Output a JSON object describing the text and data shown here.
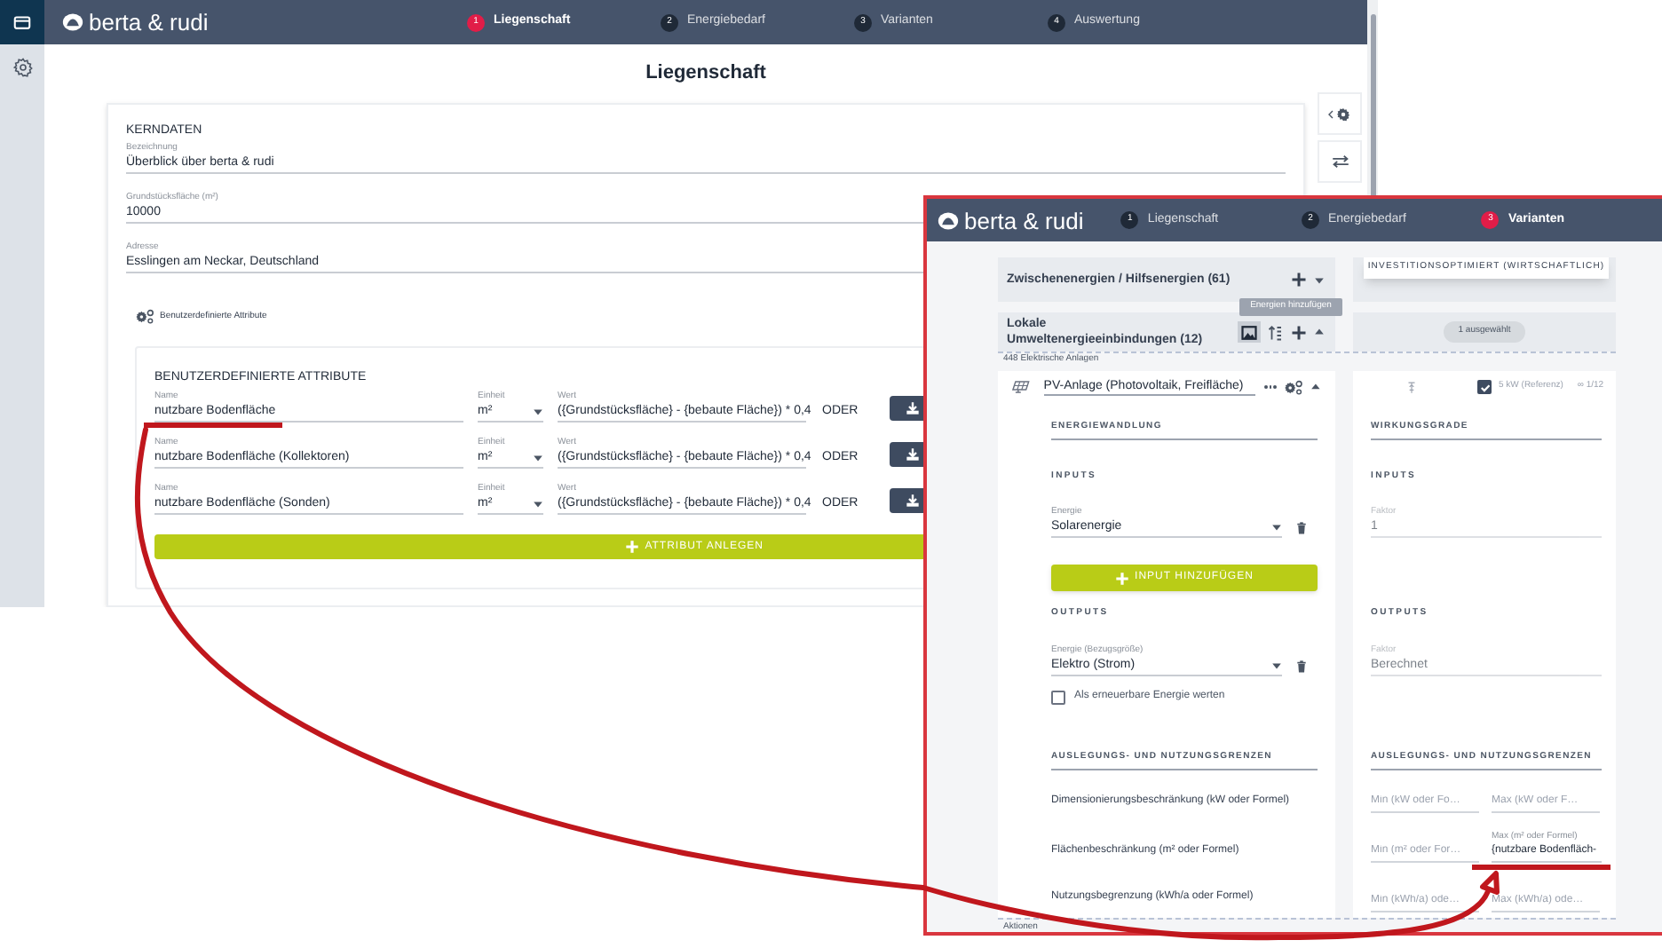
{
  "back_window": {
    "logo": "berta & rudi",
    "steps": [
      {
        "number": "1",
        "label": "Liegenschaft",
        "selected": true
      },
      {
        "number": "2",
        "label": "Energiebedarf",
        "selected": false
      },
      {
        "number": "3",
        "label": "Varianten",
        "selected": false
      },
      {
        "number": "4",
        "label": "Auswertung",
        "selected": false
      }
    ],
    "page_title": "Liegenschaft",
    "core_data": {
      "heading": "KERNDATEN",
      "fields": [
        {
          "label": "Bezeichnung",
          "value": "Überblick über berta & rudi"
        },
        {
          "label": "Grundstücksfläche (m²)",
          "value": "10000"
        },
        {
          "label": "Adresse",
          "value": "Esslingen am Neckar, Deutschland"
        }
      ]
    },
    "custom_attributes": {
      "section_title": "Benutzerdefinierte Attribute",
      "heading": "BENUTZERDEFINIERTE ATTRIBUTE",
      "rows": [
        {
          "name_label": "Name",
          "name": "nutzbare Bodenfläche",
          "unit_label": "Einheit",
          "unit": "m²",
          "value_label": "Wert",
          "value": "({Grundstücksfläche} - {bebaute Fläche}) * 0,4",
          "or": "ODER",
          "highlighted": true
        },
        {
          "name_label": "Name",
          "name": "nutzbare Bodenfläche (Kollektoren)",
          "unit_label": "Einheit",
          "unit": "m²",
          "value_label": "Wert",
          "value": "({Grundstücksfläche} - {bebaute Fläche}) * 0,4",
          "or": "ODER",
          "highlighted": false
        },
        {
          "name_label": "Name",
          "name": "nutzbare Bodenfläche (Sonden)",
          "unit_label": "Einheit",
          "unit": "m²",
          "value_label": "Wert",
          "value": "({Grundstücksfläche} - {bebaute Fläche}) * 0,4",
          "or": "ODER",
          "highlighted": false
        }
      ],
      "add_button": "ATTRIBUT ANLEGEN"
    }
  },
  "front_window": {
    "logo": "berta & rudi",
    "steps": [
      {
        "number": "1",
        "label": "Liegenschaft",
        "selected": false
      },
      {
        "number": "2",
        "label": "Energiebedarf",
        "selected": false
      },
      {
        "number": "3",
        "label": "Varianten",
        "selected": true
      }
    ],
    "groups": [
      {
        "title": "Zwischenenergien / Hilfsenergien (61)",
        "expanded": false
      },
      {
        "title": "Lokale Umweltenergieeinbindungen (12)",
        "expanded": true
      }
    ],
    "variant_header": "INVESTITIONSOPTIMIERT (WIRTSCHAFTLICH)",
    "selection_chip": "1 ausgewählt",
    "tooltip": "Energien hinzufügen",
    "category": "448 Elektrische Anlagen",
    "plant": {
      "name": "PV-Anlage (Photovoltaik, Freifläche)",
      "checked": true,
      "size": "5 kW (Referenz)",
      "count": "∞ 1/12"
    },
    "conversion": {
      "heading": "ENERGIEWANDLUNG",
      "inputs_heading": "INPUTS",
      "input": {
        "label": "Energie",
        "value": "Solarenergie"
      },
      "add_input": "INPUT HINZUFÜGEN",
      "outputs_heading": "OUTPUTS",
      "output": {
        "label": "Energie (Bezugsgröße)",
        "value": "Elektro (Strom)"
      },
      "renewable": {
        "label": "Als erneuerbare Energie werten",
        "checked": false
      }
    },
    "efficiency": {
      "heading": "WIRKUNGSGRADE",
      "inputs_heading": "INPUTS",
      "input_factor": {
        "label": "Faktor",
        "value": "1"
      },
      "outputs_heading": "OUTPUTS",
      "output_factor": {
        "label": "Faktor",
        "value": "Berechnet"
      }
    },
    "limits": {
      "heading_left": "AUSLEGUNGS- UND NUTZUNGSGRENZEN",
      "heading_right": "AUSLEGUNGS- UND NUTZUNGSGRENZEN",
      "rows": [
        {
          "label": "Dimensionierungsbeschränkung (kW oder Formel)",
          "min": {
            "placeholder": "Min (kW oder Fo…"
          },
          "max": {
            "placeholder": "Max (kW oder F…"
          }
        },
        {
          "label": "Flächenbeschränkung (m² oder Formel)",
          "min": {
            "placeholder": "Min (m² oder For…"
          },
          "max": {
            "label": "Max (m² oder Formel)",
            "value": "{nutzbare Bodenfläch-",
            "highlighted": true
          }
        },
        {
          "label": "Nutzungsbegrenzung (kWh/a oder Formel)",
          "min": {
            "placeholder": "Min (kWh/a) ode…"
          },
          "max": {
            "placeholder": "Max (kWh/a) ode…"
          }
        }
      ]
    },
    "footer": "Aktionen"
  }
}
